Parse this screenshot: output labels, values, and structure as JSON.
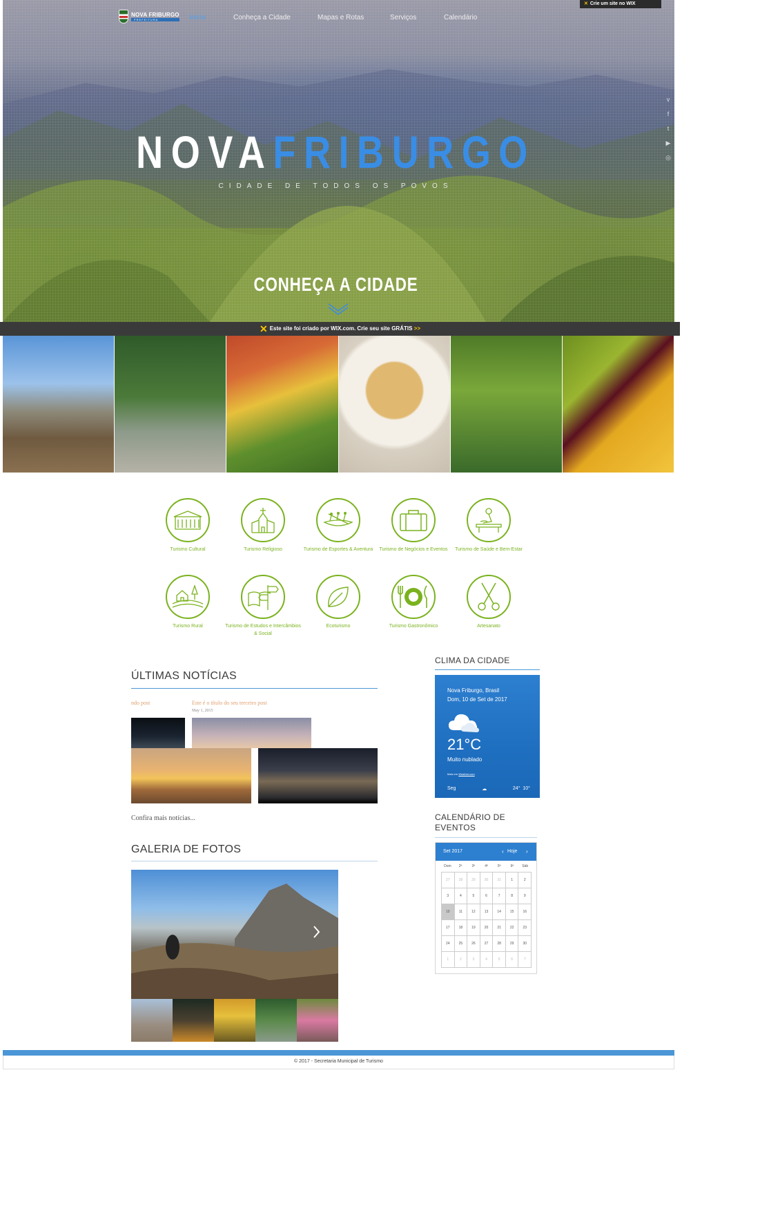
{
  "nav": {
    "logo_name": "NOVA FRIBURGO",
    "logo_sub": "PREFEITURA",
    "items": [
      "Início",
      "Conheça a Cidade",
      "Mapas e Rotas",
      "Serviços",
      "Calendário"
    ]
  },
  "wix_badge": "Crie um site no WIX",
  "social_icons": [
    "vimeo-icon",
    "facebook-icon",
    "twitter-icon",
    "youtube-icon",
    "instagram-icon"
  ],
  "hero": {
    "brand_white": "NOVA",
    "brand_blue": "FRIBURGO",
    "tagline": "CIDADE DE TODOS OS POVOS",
    "cta": "CONHEÇA A CIDADE"
  },
  "wix_bar": {
    "text": "Este site foi criado por WIX.com. Crie seu site GRÁTIS",
    "arrow": ">>"
  },
  "categories": [
    "Turismo Cultural",
    "Turismo Religioso",
    "Turismo de Esportes & Aventura",
    "Turismo de Negócios e Eventos",
    "Turismo de Saúde e Bem-Estar",
    "Turismo Rural",
    "Turismo de Estudos e Intercâmbios & Social",
    "Ecoturismo",
    "Turismo Gastronômico",
    "Artesanato"
  ],
  "news": {
    "heading": "ÚLTIMAS NOTÍCIAS",
    "post_prev_fragment": "ndo post",
    "post_title": "Este é o título do seu terceiro post",
    "post_date": "May 1, 2015",
    "more_link": "Confira mais notícias..."
  },
  "gallery": {
    "heading": "GALERIA DE FOTOS"
  },
  "weather": {
    "heading": "CLIMA DA CIDADE",
    "location": "Nova Friburgo, Brasil",
    "date": "Dom, 10 de Set de 2017",
    "temp": "21°C",
    "condition": "Muito nublado",
    "source_prefix": "Mais em",
    "source": "Weather.com",
    "forecast_day": "Seg",
    "forecast_high": "24°",
    "forecast_low": "10°"
  },
  "calendar": {
    "heading": "CALENDÁRIO DE EVENTOS",
    "month": "Set 2017",
    "today_label": "Hoje",
    "dows": [
      "Dom",
      "2ª",
      "3ª",
      "4ª",
      "5ª",
      "6ª",
      "Sáb"
    ],
    "weeks": [
      [
        "27",
        "28",
        "29",
        "30",
        "31",
        "1",
        "2"
      ],
      [
        "3",
        "4",
        "5",
        "6",
        "7",
        "8",
        "9"
      ],
      [
        "10",
        "11",
        "12",
        "13",
        "14",
        "15",
        "16"
      ],
      [
        "17",
        "18",
        "19",
        "20",
        "21",
        "22",
        "23"
      ],
      [
        "24",
        "25",
        "26",
        "27",
        "28",
        "29",
        "30"
      ],
      [
        "1",
        "2",
        "3",
        "4",
        "5",
        "6",
        "7"
      ]
    ]
  },
  "footer": {
    "text": "© 2017 - Secretaria Municipal de Turismo"
  },
  "colors": {
    "accent_green": "#7ab21e",
    "accent_blue": "#2d7fd0",
    "brand_blue": "#3a8de4"
  }
}
